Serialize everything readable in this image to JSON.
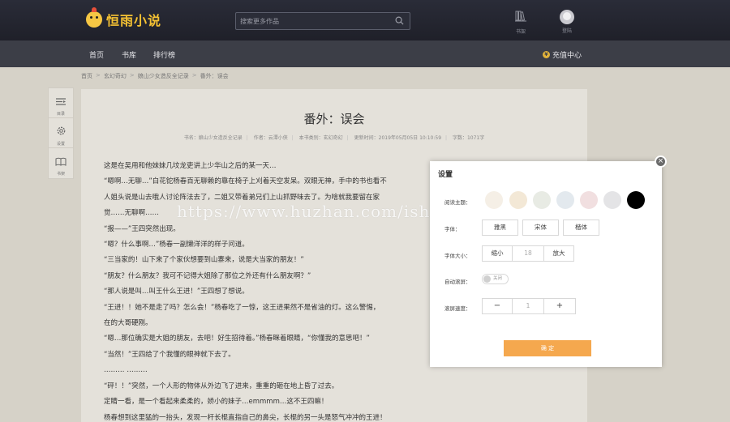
{
  "header": {
    "logo_text": "恒雨小说",
    "search_placeholder": "搜索更多作品",
    "shelf_label": "书架",
    "login_label": "登陆"
  },
  "nav": {
    "items": [
      "首页",
      "书库",
      "排行榜"
    ],
    "recharge": "充值中心"
  },
  "breadcrumb": [
    "首页",
    "玄幻奇幻",
    "娘山少女造反全记录",
    "番外：误会"
  ],
  "side_tools": [
    {
      "label": "目录",
      "icon": "catalog-icon"
    },
    {
      "label": "设置",
      "icon": "gear-icon"
    },
    {
      "label": "书架",
      "icon": "bookshelf-icon"
    }
  ],
  "chapter": {
    "title": "番外：误会",
    "meta": {
      "book": "书名：娘山少女造反全记录",
      "author": "作者：云潭小侠",
      "category": "本书类别：玄幻奇幻",
      "updated": "更新时间：2019年05月05日 10:10:59",
      "words": "字数：1071字"
    },
    "paragraphs": [
      "这是在吴用和他妹妹几坟龙吏讲上少华山之后的某一天…",
      "“嗯啊…无聊…”白花铊杨春百无聊赖的靠在椅子上刈着天空发呆。双眼无神，手中的书也看不",
      "人姐头说是山去哦人讨论阵法去了，二姐又带着弟兄们上山抓野味去了。为啥就我要留在家",
      "觉……无聊啊……",
      "“报——”王四突然出现。",
      "“嗯？什么事啊…”杨春一副懒洋洋的样子问道。",
      "“三当家的！山下来了个家伙想要到山寨来，说是大当家的朋友！”",
      "“朋友？什么朋友？我可不记得大姐除了那位之外还有什么朋友啊？”",
      "“那人说是叫…叫王什么王进！”王四想了想说。",
      "“王进！！她不是走了吗？怎么会！”杨春吃了一惊，这王进果然不是省油的灯。这么警惕，",
      "在的大哥硬刚。",
      "“嗯…那位确实是大姐的朋友，去吧！好生招待着。”杨春眯着眼睛，“你懂我的意思吧！”",
      "“当然！”王四给了个我懂的眼神就下去了。",
      "……… ………",
      "“砰！！”突然，一个人形的物体从外边飞了进来，重重的砸在地上昏了过去。",
      "定睛一看，是一个看起来柔柔的，娇小的妹子…emmmm…这不王四嘛！",
      "杨春想到这里猛的一抬头，发现一杆长棍直指自己的鼻尖，长棍的另一头是怒气冲冲的王进！"
    ]
  },
  "watermark": "https://www.huzhan.com/ishop18301",
  "settings": {
    "title": "设置",
    "theme_label": "阅读主题：",
    "theme_colors": [
      "#f5efe6",
      "#f3e8d6",
      "#e8ebe4",
      "#e3e9ee",
      "#f1dfe0",
      "#e4e4e6",
      "#000000"
    ],
    "font_label": "字体：",
    "fonts": [
      "雅黑",
      "宋体",
      "楷体"
    ],
    "size_label": "字体大小：",
    "size_minus": "缩小",
    "size_value": "18",
    "size_plus": "放大",
    "autoscroll_label": "自动滚屏：",
    "autoscroll_state": "关闭",
    "speed_label": "滚屏速度：",
    "speed_minus": "−",
    "speed_value": "1",
    "speed_plus": "+",
    "confirm": "确 定",
    "close": "×"
  }
}
